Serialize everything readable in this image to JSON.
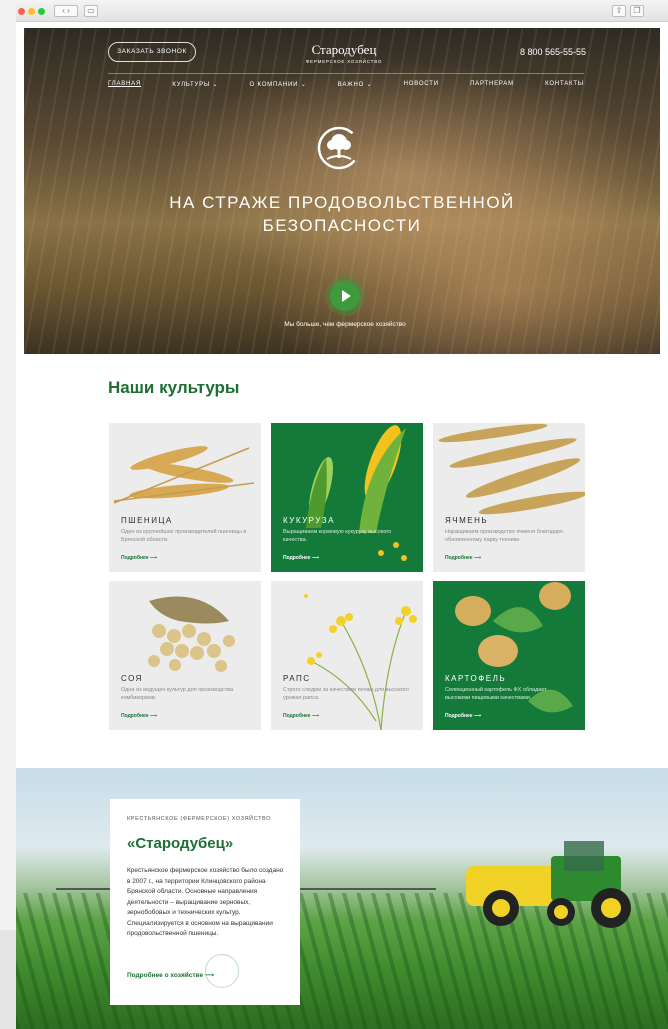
{
  "header": {
    "call_label": "Заказать звонок",
    "brand_name": "Стародубец",
    "brand_sub": "фермерское хозяйство",
    "phone": "8 800 565-55-55",
    "nav": [
      "Главная",
      "Культуры ⌄",
      "О компании ⌄",
      "Важно ⌄",
      "Новости",
      "Партнерам",
      "Контакты"
    ]
  },
  "hero": {
    "title": "На страже продовольственной безопасности",
    "subtitle": "Мы больше, чем фермерское хозяйство"
  },
  "cultures": {
    "title": "Наши культуры",
    "more_label": "Подробнее ⟶",
    "items": [
      {
        "name": "Пшеница",
        "desc": "Один из крупнейших производителей пшеницы в Брянской области."
      },
      {
        "name": "Кукуруза",
        "desc": "Выращиваем кормовую кукурузу высокого качества."
      },
      {
        "name": "Ячмень",
        "desc": "Наращиваем производство ячменя благодаря обновленному парку техники."
      },
      {
        "name": "Соя",
        "desc": "Одна из ведущих культур для производства комбикормов."
      },
      {
        "name": "Рапс",
        "desc": "Строго следим за качеством почвы для высокого урожая рапса."
      },
      {
        "name": "Картофель",
        "desc": "Селекционный картофель ФХ обладает высокими пищевыми качествами."
      }
    ]
  },
  "about": {
    "kicker": "Крестьянское (фермерское) хозяйство",
    "title": "«Стародубец»",
    "text": "Крестьянское фермерское хозяйство было создано в 2007 г., на территории Клинцовского района Брянской области. Основные направления деятельности – выращивание зерновых, зернобобовых и технических культур. Специализируется в основном на выращивании продовольственной пшеницы.",
    "link": "Подробнее о хозяйстве ⟶"
  },
  "colors": {
    "brand_green": "#137a3a",
    "accent_text": "#1d6f34"
  }
}
